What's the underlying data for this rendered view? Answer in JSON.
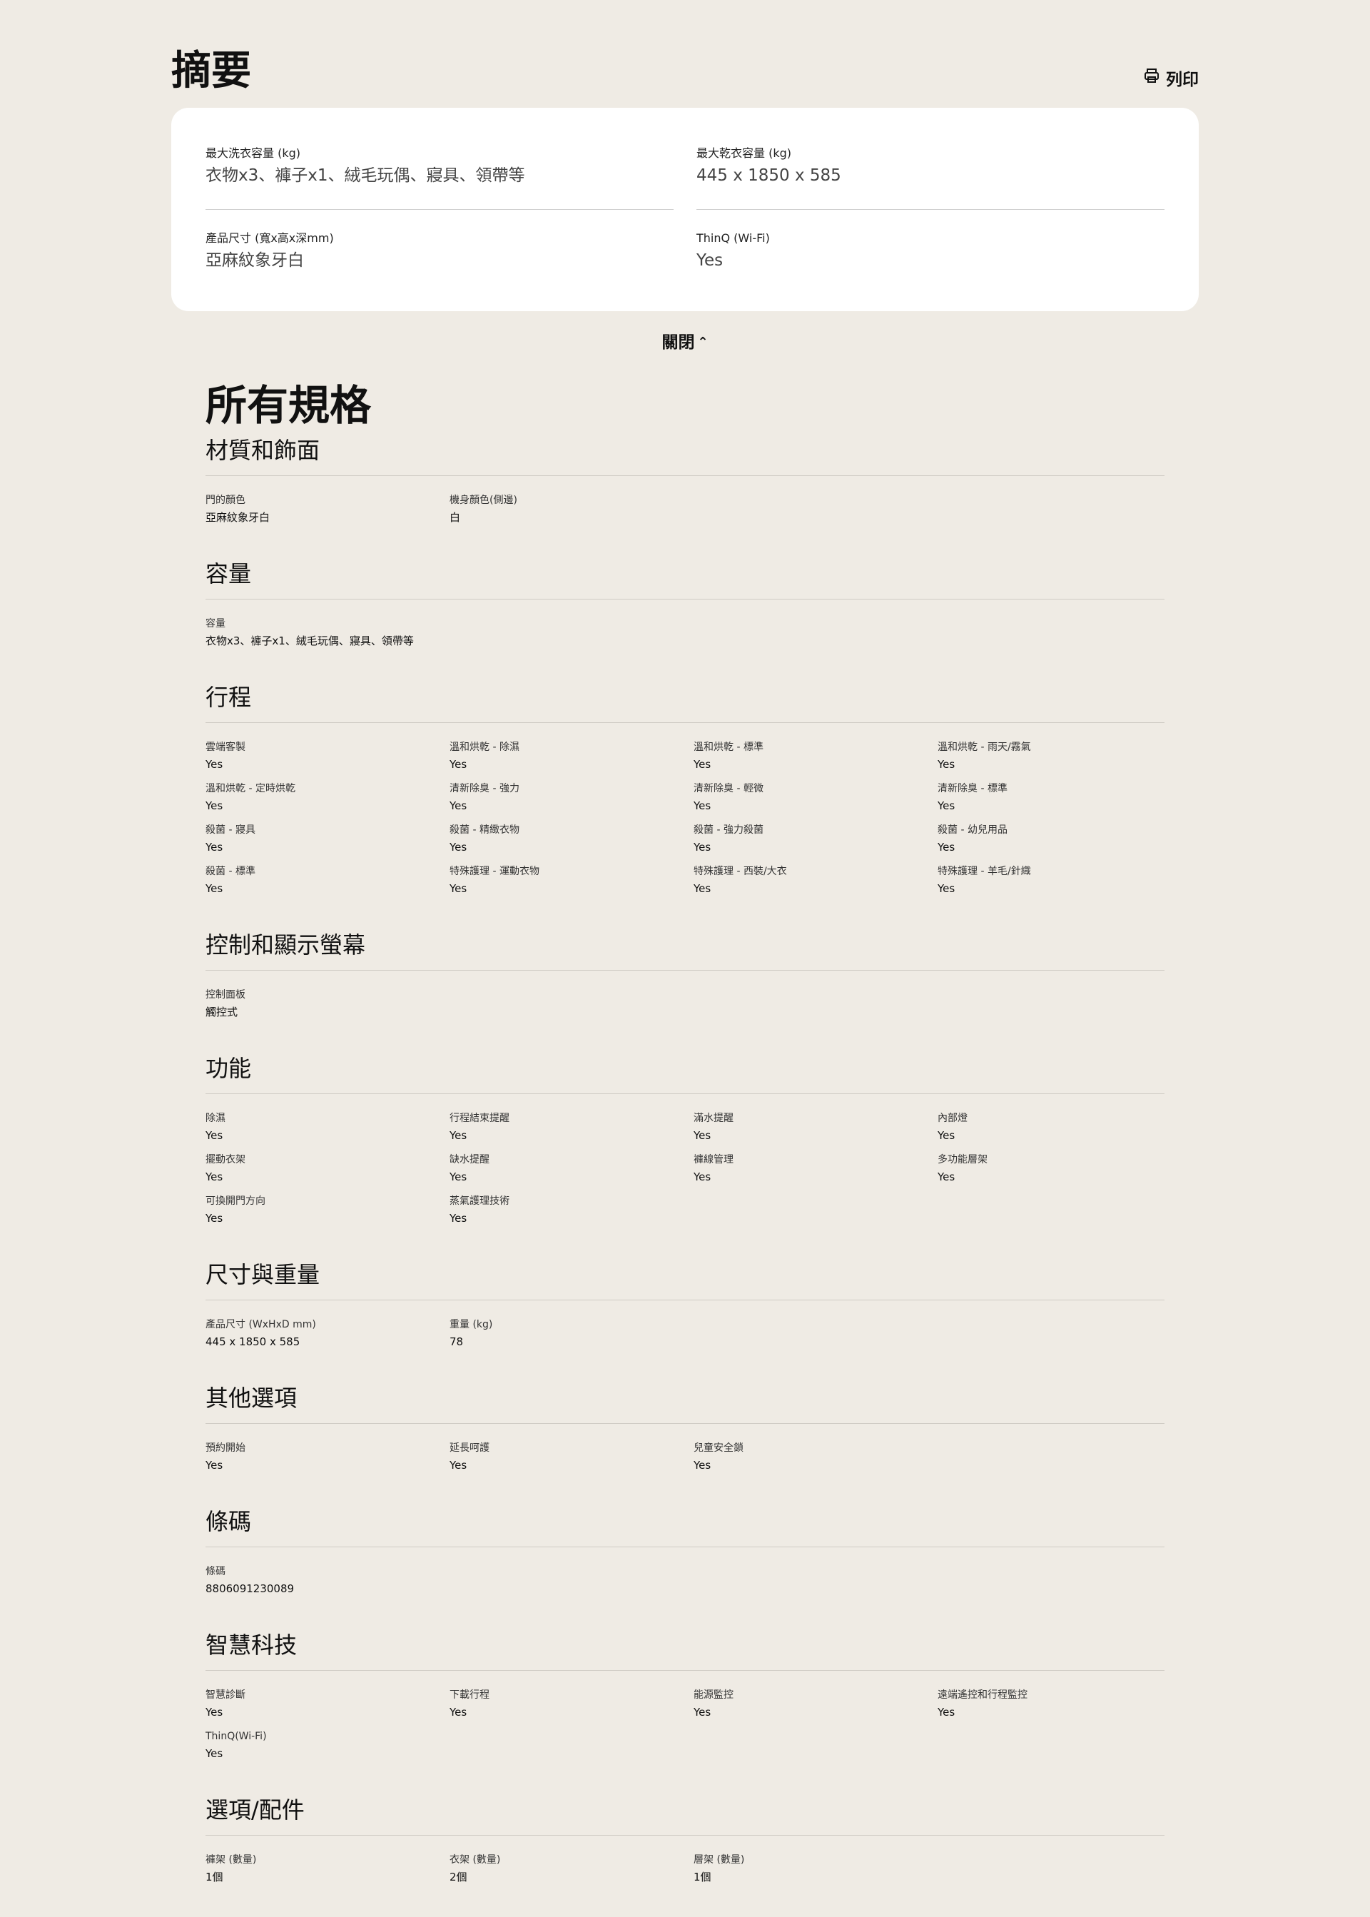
{
  "summary": {
    "title": "摘要",
    "print_label": "列印",
    "items": [
      {
        "label": "最大洗衣容量 (kg)",
        "value": "衣物x3、褲子x1、絨毛玩偶、寢具、領帶等"
      },
      {
        "label": "最大乾衣容量 (kg)",
        "value": "445 x 1850 x 585"
      },
      {
        "label": "產品尺寸 (寬x高x深mm)",
        "value": "亞麻紋象牙白"
      },
      {
        "label": "ThinQ (Wi-Fi)",
        "value": "Yes"
      }
    ],
    "close_label": "關閉"
  },
  "specs": {
    "title": "所有規格",
    "sections": [
      {
        "title": "材質和飾面",
        "items": [
          {
            "label": "門的顏色",
            "value": "亞麻紋象牙白"
          },
          {
            "label": "機身顏色(側邊)",
            "value": "白"
          }
        ]
      },
      {
        "title": "容量",
        "items": [
          {
            "label": "容量",
            "value": "衣物x3、褲子x1、絨毛玩偶、寢具、領帶等"
          }
        ]
      },
      {
        "title": "行程",
        "items": [
          {
            "label": "雲端客製",
            "value": "Yes"
          },
          {
            "label": "溫和烘乾 - 除濕",
            "value": "Yes"
          },
          {
            "label": "溫和烘乾 - 標準",
            "value": "Yes"
          },
          {
            "label": "溫和烘乾 - 雨天/霧氣",
            "value": "Yes"
          },
          {
            "label": "溫和烘乾 - 定時烘乾",
            "value": "Yes"
          },
          {
            "label": "清新除臭 - 強力",
            "value": "Yes"
          },
          {
            "label": "清新除臭 - 輕微",
            "value": "Yes"
          },
          {
            "label": "清新除臭 - 標準",
            "value": "Yes"
          },
          {
            "label": "殺菌 - 寢具",
            "value": "Yes"
          },
          {
            "label": "殺菌 - 精緻衣物",
            "value": "Yes"
          },
          {
            "label": "殺菌 - 強力殺菌",
            "value": "Yes"
          },
          {
            "label": "殺菌 - 幼兒用品",
            "value": "Yes"
          },
          {
            "label": "殺菌 - 標準",
            "value": "Yes"
          },
          {
            "label": "特殊護理 - 運動衣物",
            "value": "Yes"
          },
          {
            "label": "特殊護理 - 西裝/大衣",
            "value": "Yes"
          },
          {
            "label": "特殊護理 - 羊毛/針織",
            "value": "Yes"
          }
        ]
      },
      {
        "title": "控制和顯示螢幕",
        "items": [
          {
            "label": "控制面板",
            "value": "觸控式"
          }
        ]
      },
      {
        "title": "功能",
        "items": [
          {
            "label": "除濕",
            "value": "Yes"
          },
          {
            "label": "行程結束提醒",
            "value": "Yes"
          },
          {
            "label": "滿水提醒",
            "value": "Yes"
          },
          {
            "label": "內部燈",
            "value": "Yes"
          },
          {
            "label": "擺動衣架",
            "value": "Yes"
          },
          {
            "label": "缺水提醒",
            "value": "Yes"
          },
          {
            "label": "褲線管理",
            "value": "Yes"
          },
          {
            "label": "多功能層架",
            "value": "Yes"
          },
          {
            "label": "可換開門方向",
            "value": "Yes"
          },
          {
            "label": "蒸氣護理技術",
            "value": "Yes"
          }
        ]
      },
      {
        "title": "尺寸與重量",
        "items": [
          {
            "label": "產品尺寸 (WxHxD mm)",
            "value": "445 x 1850 x 585"
          },
          {
            "label": "重量 (kg)",
            "value": "78"
          }
        ]
      },
      {
        "title": "其他選項",
        "items": [
          {
            "label": "預約開始",
            "value": "Yes"
          },
          {
            "label": "延長呵護",
            "value": "Yes"
          },
          {
            "label": "兒童安全鎖",
            "value": "Yes"
          }
        ]
      },
      {
        "title": "條碼",
        "items": [
          {
            "label": "條碼",
            "value": "8806091230089"
          }
        ]
      },
      {
        "title": "智慧科技",
        "items": [
          {
            "label": "智慧診斷",
            "value": "Yes"
          },
          {
            "label": "下載行程",
            "value": "Yes"
          },
          {
            "label": "能源監控",
            "value": "Yes"
          },
          {
            "label": "遠端遙控和行程監控",
            "value": "Yes"
          },
          {
            "label": "ThinQ(Wi-Fi)",
            "value": "Yes"
          }
        ]
      },
      {
        "title": "選項/配件",
        "items": [
          {
            "label": "褲架 (數量)",
            "value": "1個"
          },
          {
            "label": "衣架 (數量)",
            "value": "2個"
          },
          {
            "label": "層架 (數量)",
            "value": "1個"
          }
        ]
      }
    ]
  }
}
